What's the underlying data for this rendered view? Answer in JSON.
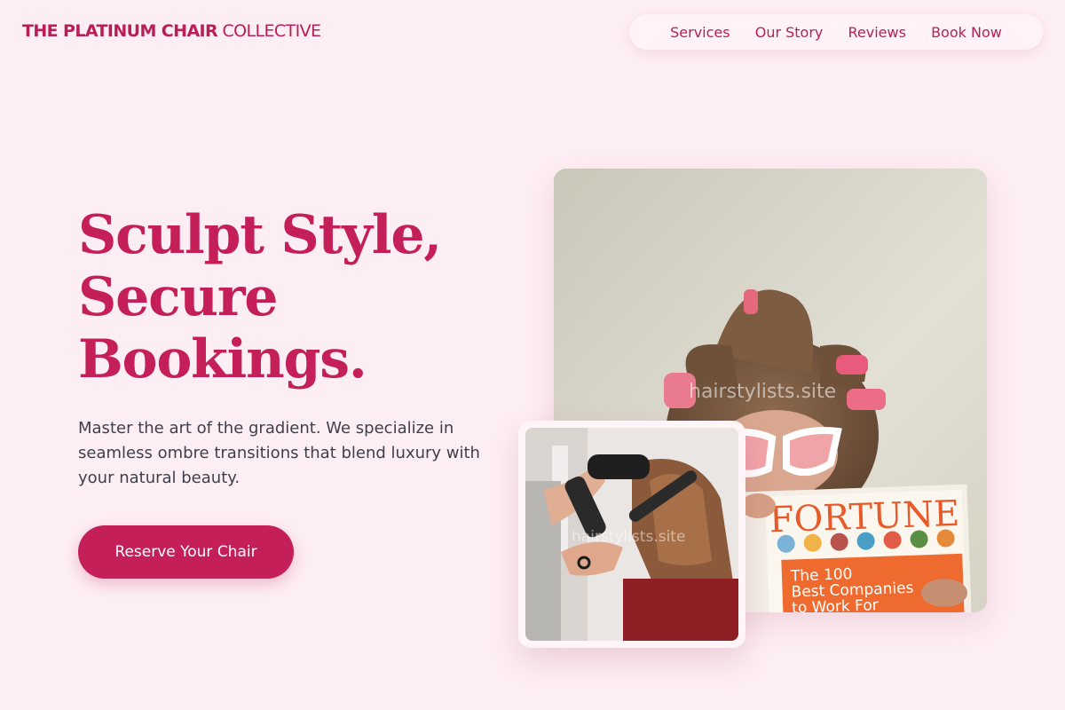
{
  "brand": {
    "name_bold": "THE PLATINUM CHAIR",
    "name_light": " COLLECTIVE"
  },
  "nav": [
    {
      "label": "Services"
    },
    {
      "label": "Our Story"
    },
    {
      "label": "Reviews"
    },
    {
      "label": "Book Now"
    }
  ],
  "hero": {
    "headline_lines": [
      "Sculpt Style,",
      "Secure",
      "Bookings."
    ],
    "subtext": "Master the art of the gradient. We specialize in seamless ombre transitions that blend luxury with your natural beauty.",
    "cta_label": "Reserve Your Chair"
  },
  "images": {
    "main": {
      "watermark": "hairstylists.site",
      "magazine_title": "FORTUNE",
      "magazine_lines": [
        "The 100",
        "Best Companies",
        "to Work For"
      ]
    },
    "secondary": {
      "watermark": "hairstylists.site"
    }
  },
  "colors": {
    "accent": "#c41f58",
    "background": "#fdeef3",
    "text": "#3f3f4b"
  }
}
